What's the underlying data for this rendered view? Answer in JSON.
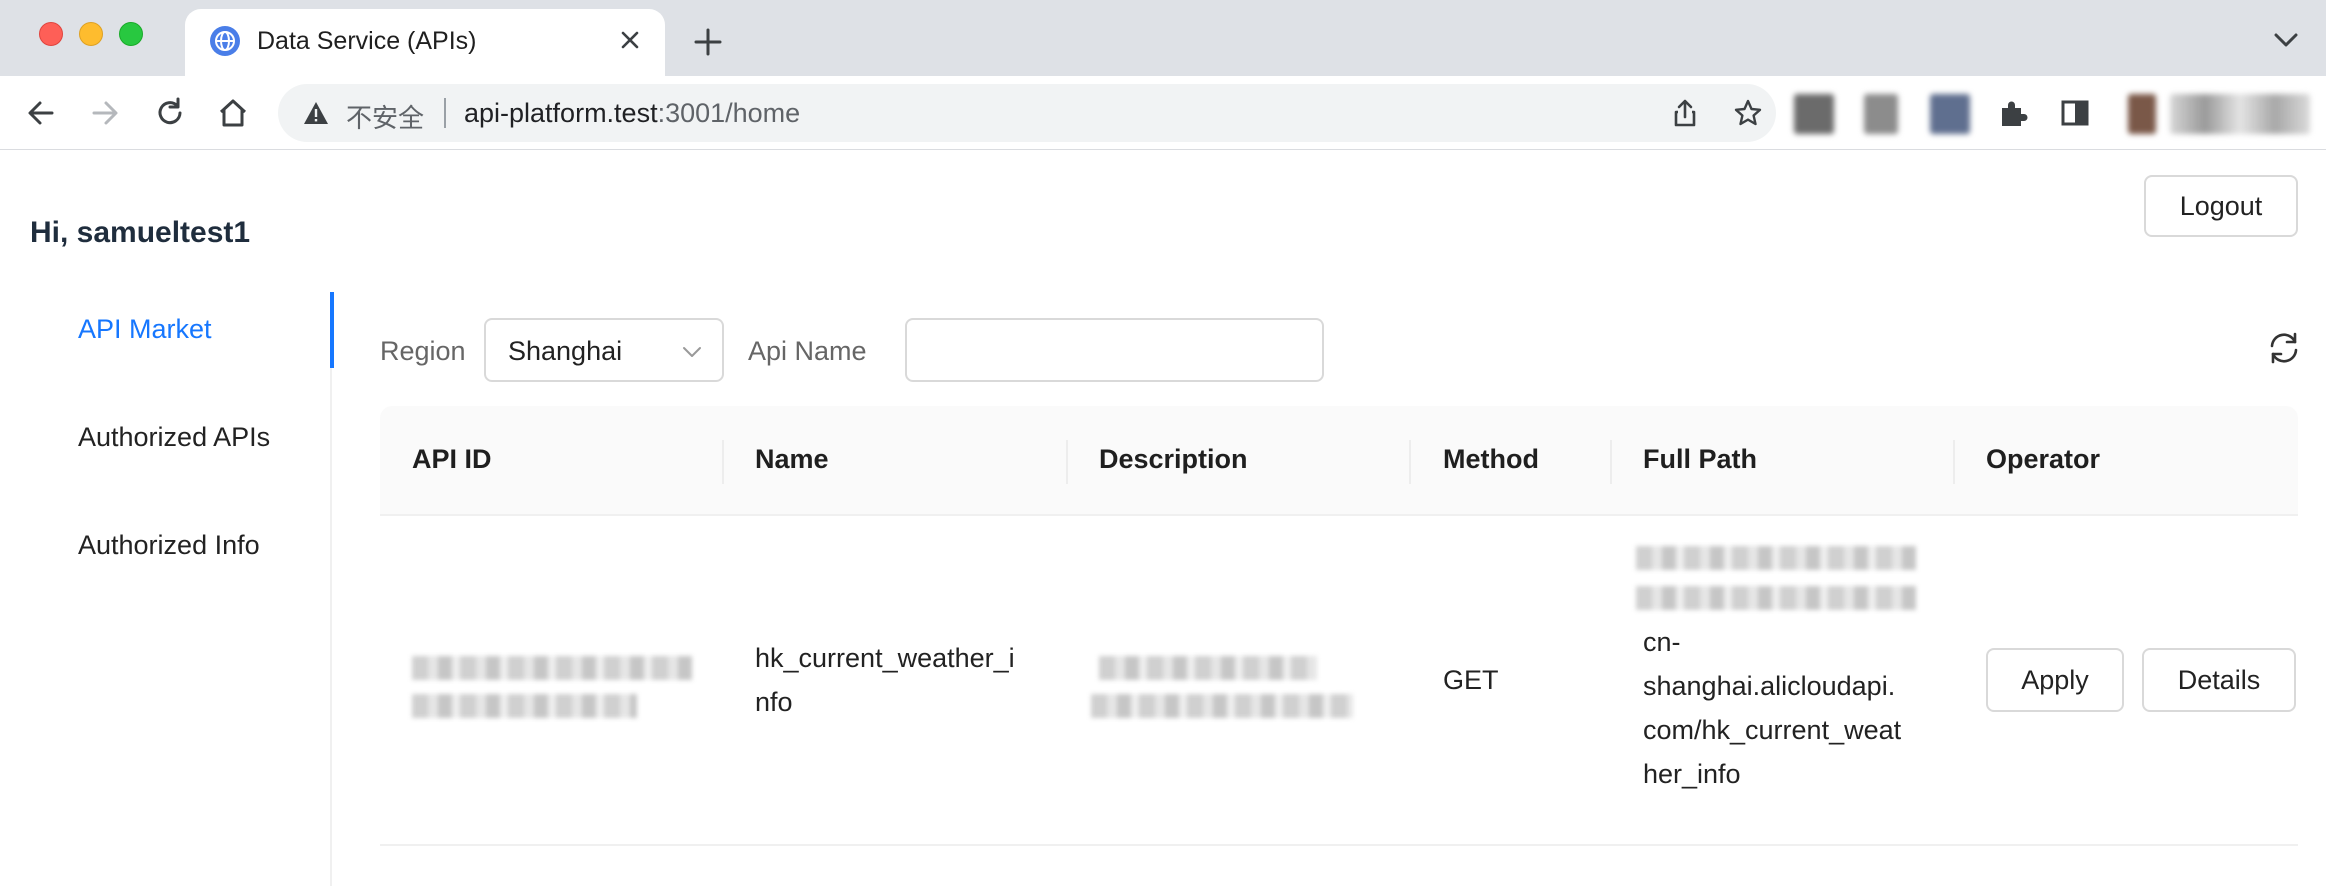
{
  "browser": {
    "tab_title": "Data Service (APIs)",
    "security_label": "不安全",
    "url_host": "api-platform.test",
    "url_rest": ":3001/home"
  },
  "header": {
    "greeting": "Hi, samueltest1",
    "logout_label": "Logout"
  },
  "sidebar": {
    "items": [
      {
        "label": "API Market",
        "active": true
      },
      {
        "label": "Authorized APIs",
        "active": false
      },
      {
        "label": "Authorized Info",
        "active": false
      }
    ]
  },
  "filters": {
    "region_label": "Region",
    "region_value": "Shanghai",
    "api_name_label": "Api Name",
    "api_name_value": ""
  },
  "table": {
    "columns": [
      "API ID",
      "Name",
      "Description",
      "Method",
      "Full Path",
      "Operator"
    ],
    "rows": [
      {
        "api_id": "",
        "name_line1": "hk_current_weather_i",
        "name_line2": "nfo",
        "description": "",
        "method": "GET",
        "full_path_lines": [
          "cn-",
          "shanghai.alicloudapi.",
          "com/hk_current_weat",
          "her_info"
        ],
        "apply_label": "Apply",
        "details_label": "Details"
      }
    ]
  },
  "colors": {
    "accent": "#1677ff",
    "border": "#d9d9d9",
    "header_bg": "#fafafa"
  }
}
